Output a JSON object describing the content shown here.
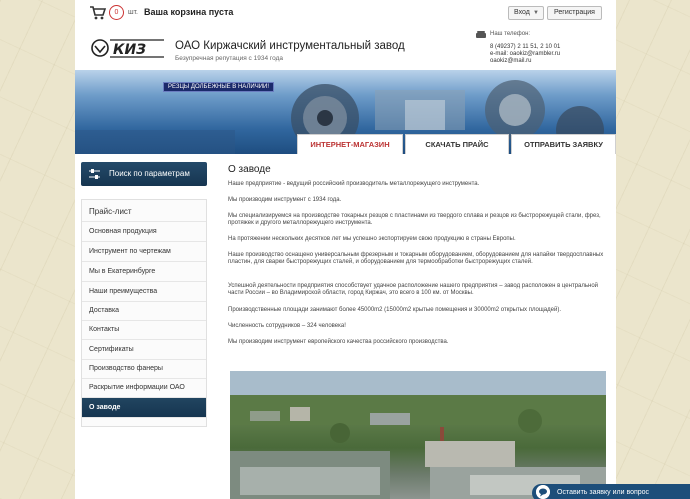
{
  "topbar": {
    "cart_count": "0",
    "cart_unit": "шт.",
    "cart_status": "Ваша корзина пуста",
    "login_label": "Вход",
    "register_label": "Регистрация"
  },
  "header": {
    "logo_text": "КИЗ",
    "company_name": "ОАО Киржачский инструментальный завод",
    "company_sub": "Безупречная репутация с 1934 года",
    "phone_label": "Наш телефон:",
    "phone_number": "8 (49237) 2 11 51, 2 10 01",
    "email_line_1": "e-mail: oaokiz@rambler.ru",
    "email_line_2": "oaokiz@mail.ru"
  },
  "banner": {
    "promo": "Резцы долбежные в наличии!"
  },
  "tabs": {
    "shop": "ИНТЕРНЕТ-МАГАЗИН",
    "price": "СКАЧАТЬ ПРАЙС",
    "request": "ОТПРАВИТЬ ЗАЯВКУ"
  },
  "sidebar": {
    "search_label": "Поиск по параметрам",
    "items": [
      {
        "label": "Прайс-лист"
      },
      {
        "label": "Основная продукция"
      },
      {
        "label": "Инструмент по чертежам"
      },
      {
        "label": "Мы в Екатеринбурге"
      },
      {
        "label": "Наши преимущества"
      },
      {
        "label": "Доставка"
      },
      {
        "label": "Контакты"
      },
      {
        "label": "Сертификаты"
      },
      {
        "label": "Производство фанеры"
      },
      {
        "label": "Раскрытие информации ОАО"
      },
      {
        "label": "О заводе"
      }
    ]
  },
  "content": {
    "title": "О заводе",
    "paragraphs": [
      "Наше предприятие - ведущий российский производитель металлорежущего инструмента.",
      "Мы производим инструмент с 1934 года.",
      "Мы специализируемся на производстве токарных резцов с пластинами из твердого сплава и резцов из быстрорежущей стали, фрез, протяжек и другого металлорежущего инструмента.",
      "На протяжении нескольких десятков лет мы успешно экспортируем свою продукцию в страны Европы.",
      "Наше производство оснащено универсальным фрезерным и токарным оборудованием, оборудованием для напайки твердосплавных пластин, для сварки быстрорежущих сталей, и оборудованием для термообработки быстрорежущих сталей.",
      "Успешной деятельности предприятия способствует удачное расположение нашего предприятия – завод расположен в центральной части России – во Владимирской области, город Киржач, это всего в 100 км. от Москвы.",
      "Производственные площади занимают более 45000m2 (15000m2 крытые помещения и 30000m2 открытых площадей).",
      "Численность сотрудников – 324 человека!",
      "Мы производим инструмент европейского качества российского производства."
    ]
  },
  "chat": {
    "label": "Оставить заявку или вопрос"
  },
  "colors": {
    "accent_dark": "#163550",
    "tab_shop": "#b33333",
    "page_bg": "#ebe5cc"
  }
}
